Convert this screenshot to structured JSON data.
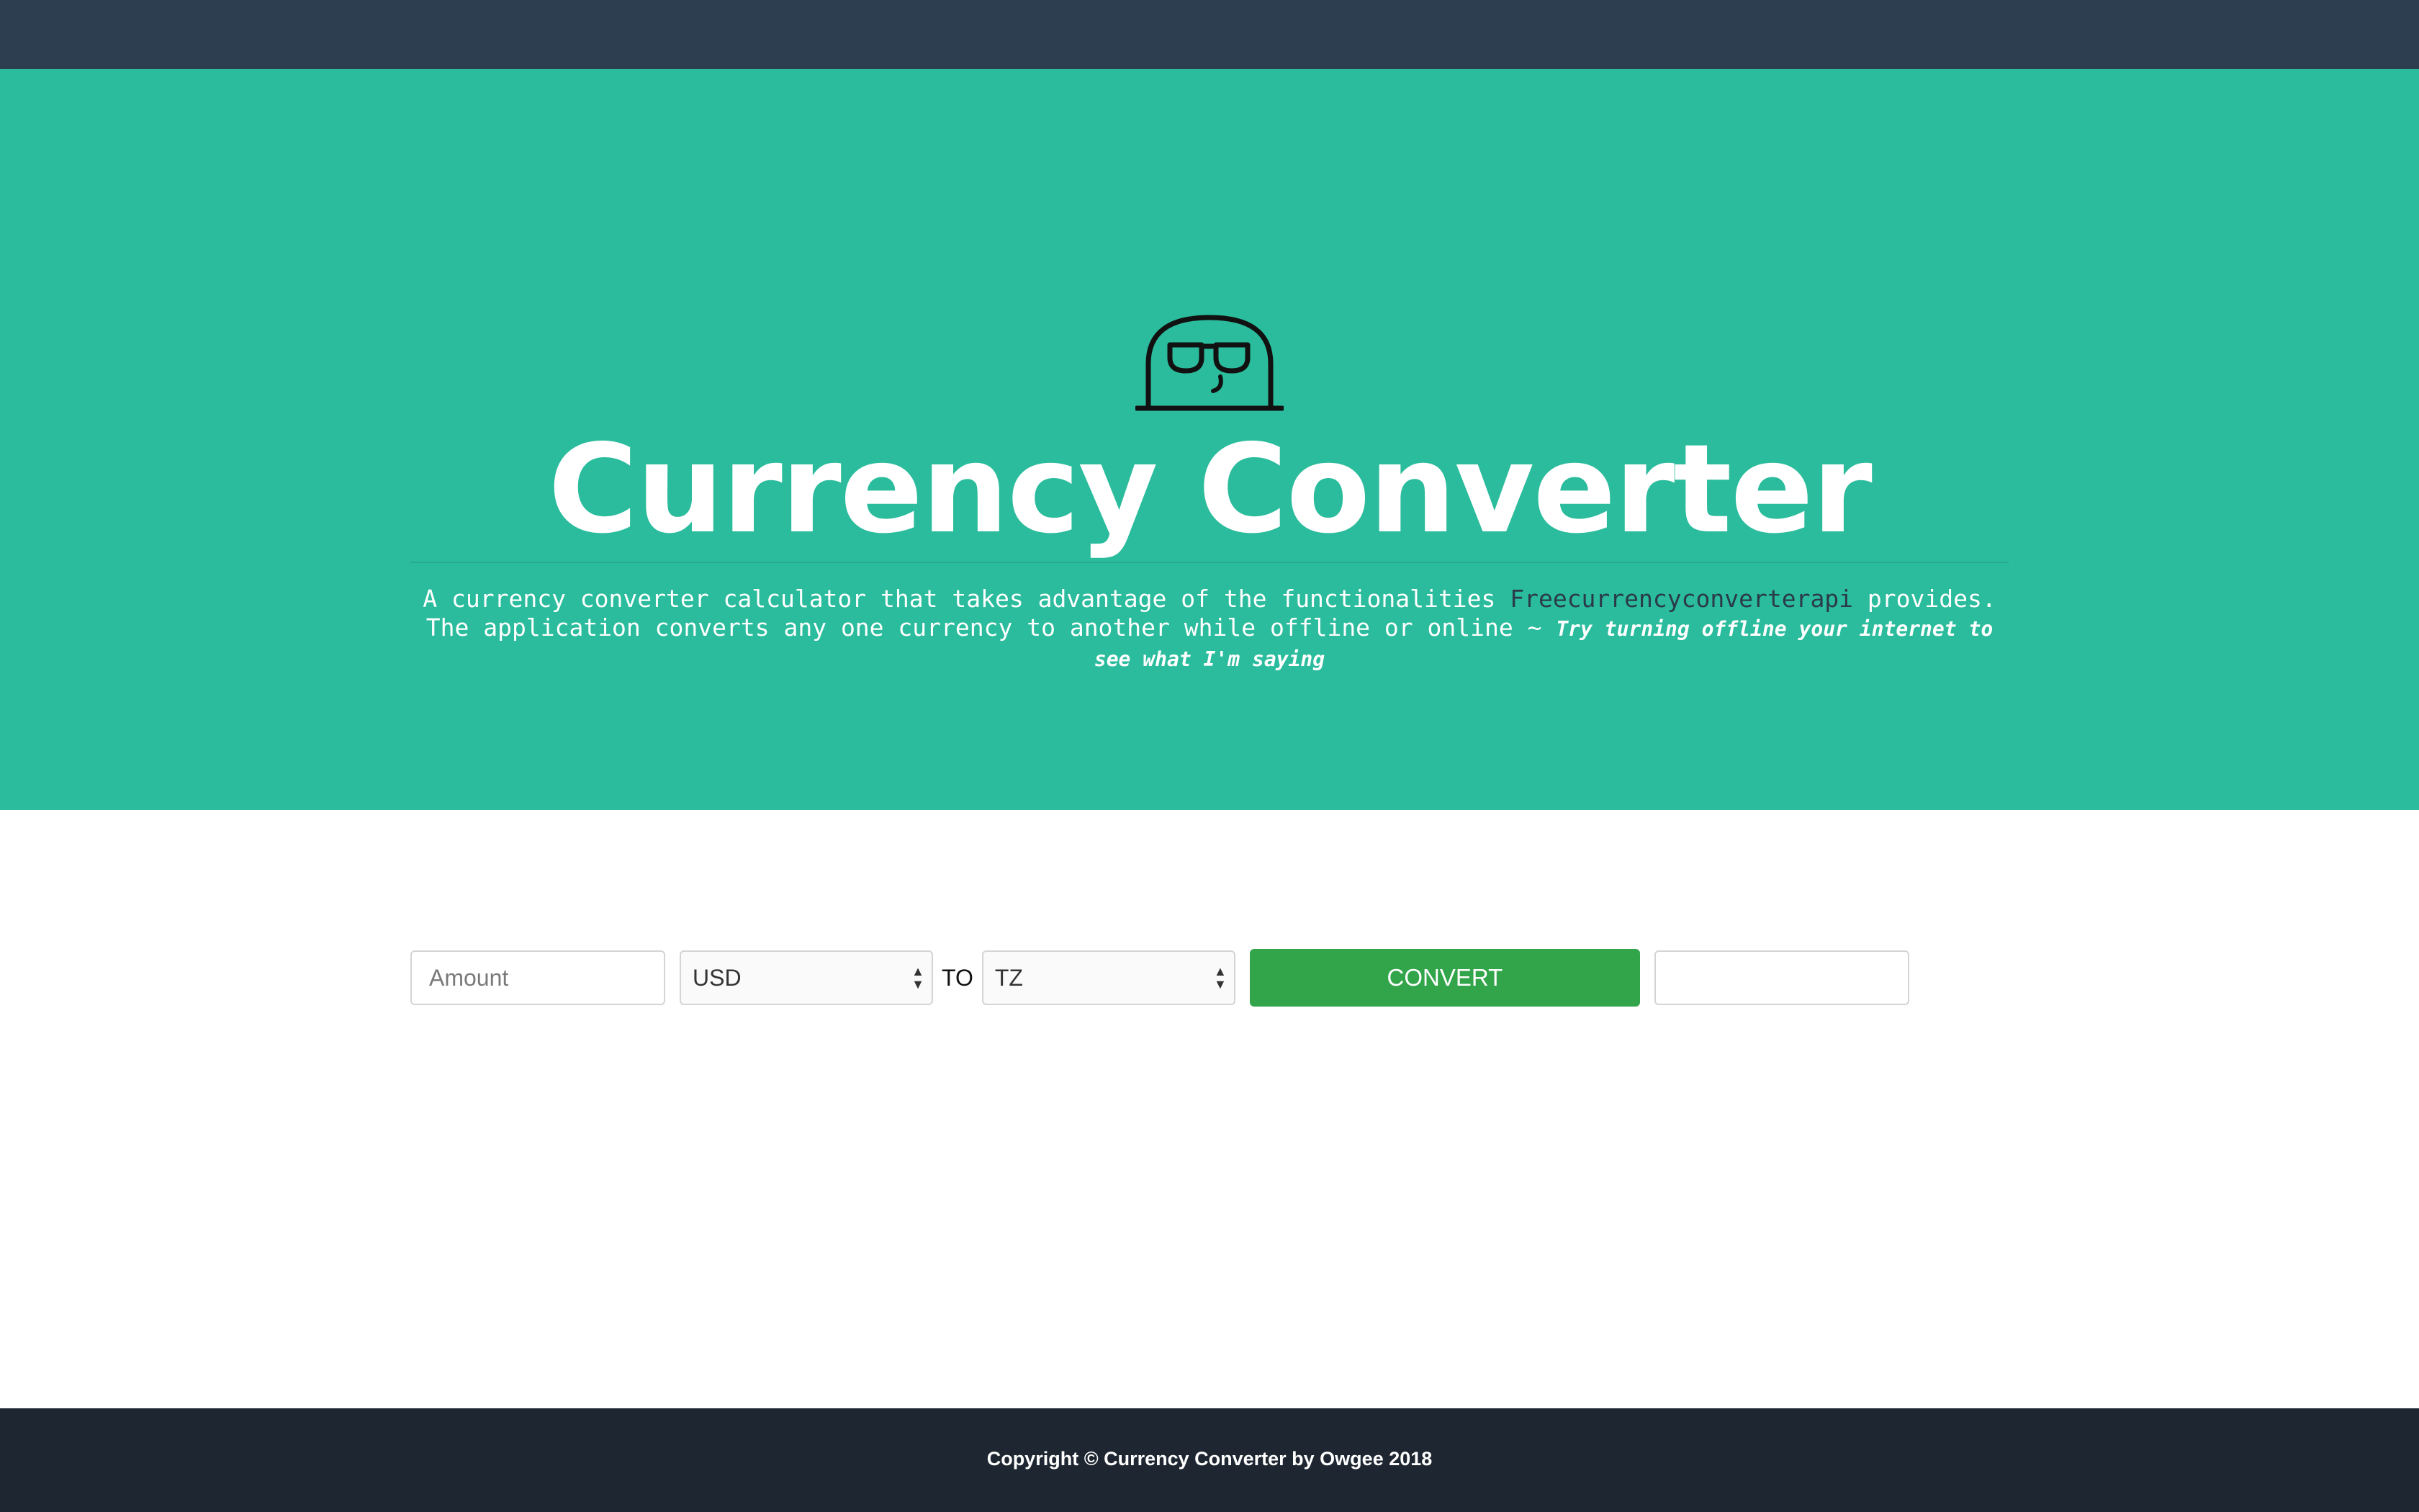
{
  "colors": {
    "topbar": "#2d3e50",
    "hero": "#2abc9c",
    "convert_button": "#32a54a",
    "footer": "#1e2631"
  },
  "hero": {
    "logo_icon": "ghost-with-sunglasses-icon",
    "title": "Currency Converter",
    "description_before": "A currency converter calculator that takes advantage of the functionalities ",
    "api_name": "Freecurrencyconverterapi",
    "description_after": " provides. The application converts any one currency to another while offline or online ~ ",
    "hint": "Try turning offline your internet to see what I'm saying"
  },
  "converter": {
    "amount_placeholder": "Amount",
    "from_currency": "USD",
    "to_label": "TO",
    "to_currency": "TZ",
    "convert_label": "CONVERT",
    "result_value": ""
  },
  "footer": {
    "copyright": "Copyright © Currency Converter by Owgee 2018"
  }
}
